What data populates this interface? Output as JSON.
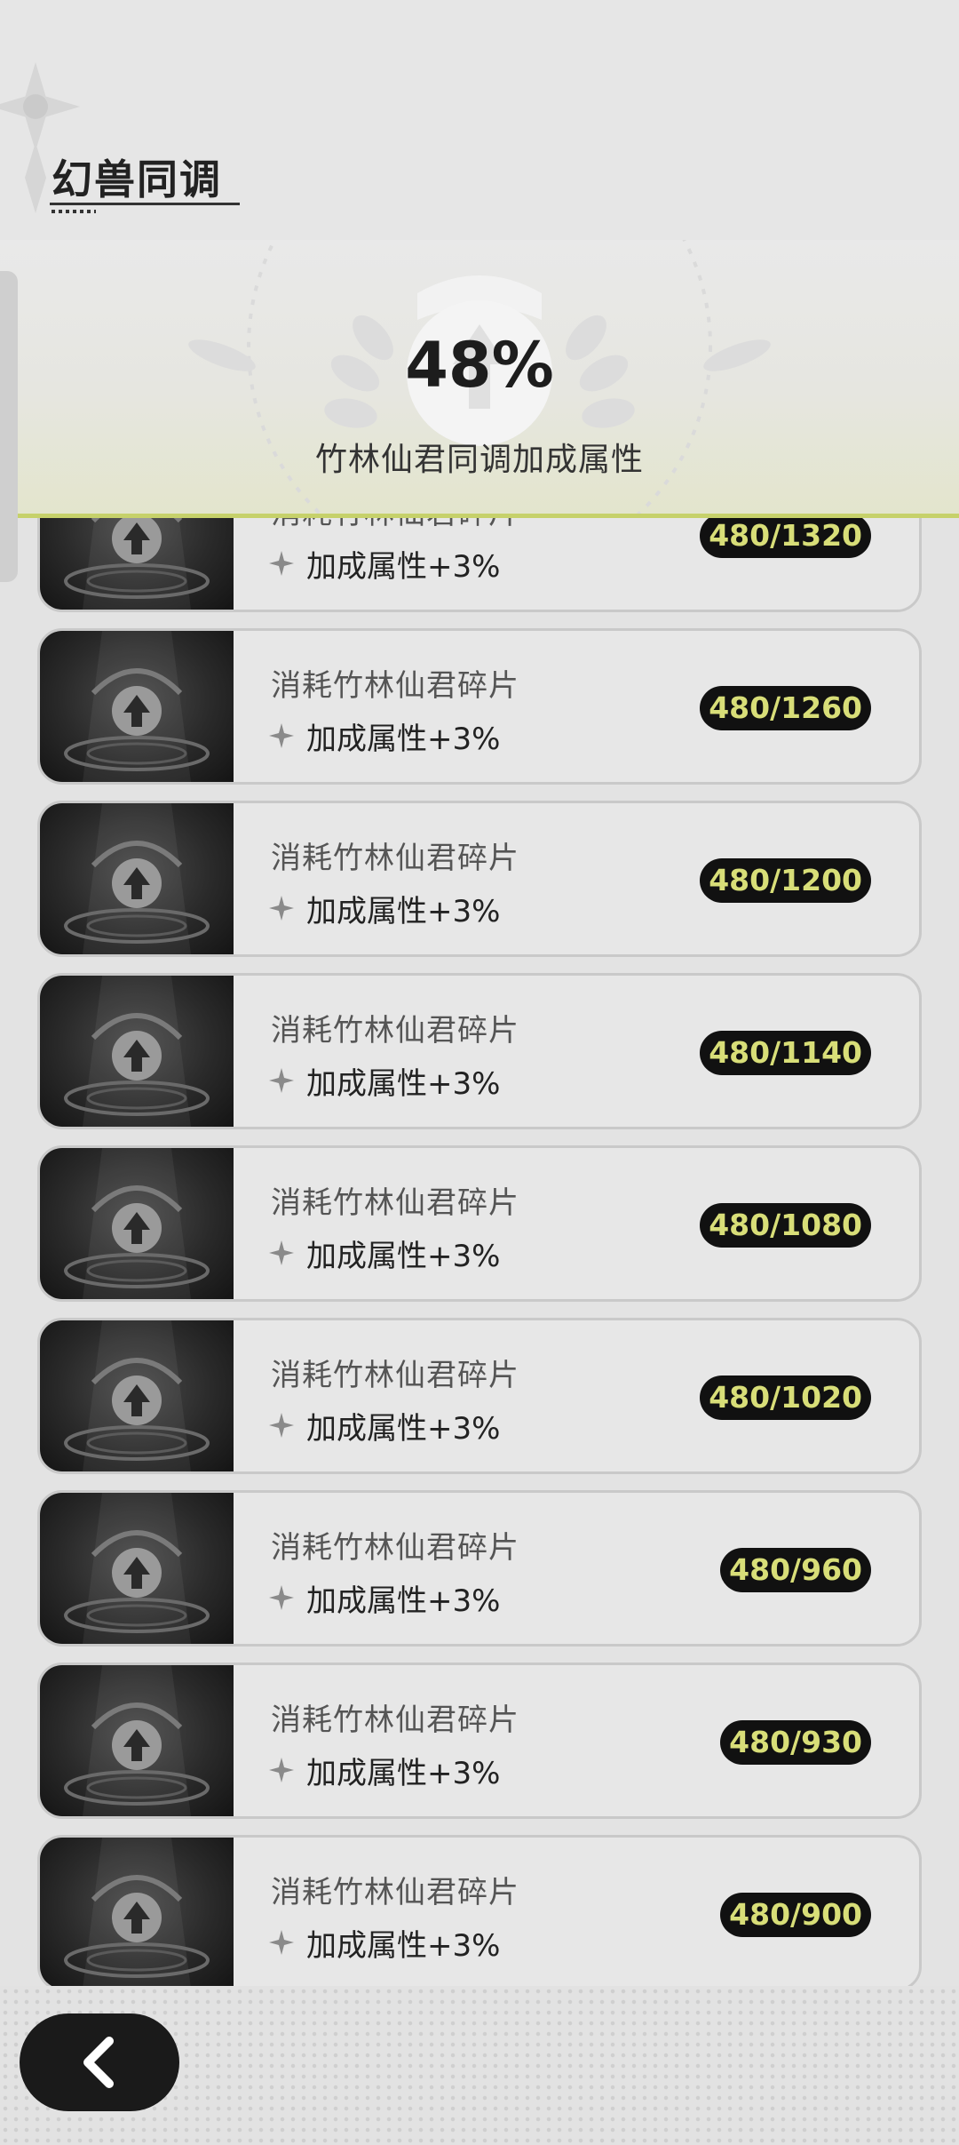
{
  "header": {
    "title": "幻兽同调"
  },
  "banner": {
    "percent": "48%",
    "subtitle": "竹林仙君同调加成属性"
  },
  "list": {
    "items": [
      {
        "title": "消耗竹林仙君碎片",
        "bonus": "加成属性+3%",
        "count": "480/1320"
      },
      {
        "title": "消耗竹林仙君碎片",
        "bonus": "加成属性+3%",
        "count": "480/1260"
      },
      {
        "title": "消耗竹林仙君碎片",
        "bonus": "加成属性+3%",
        "count": "480/1200"
      },
      {
        "title": "消耗竹林仙君碎片",
        "bonus": "加成属性+3%",
        "count": "480/1140"
      },
      {
        "title": "消耗竹林仙君碎片",
        "bonus": "加成属性+3%",
        "count": "480/1080"
      },
      {
        "title": "消耗竹林仙君碎片",
        "bonus": "加成属性+3%",
        "count": "480/1020"
      },
      {
        "title": "消耗竹林仙君碎片",
        "bonus": "加成属性+3%",
        "count": "480/960"
      },
      {
        "title": "消耗竹林仙君碎片",
        "bonus": "加成属性+3%",
        "count": "480/930"
      },
      {
        "title": "消耗竹林仙君碎片",
        "bonus": "加成属性+3%",
        "count": "480/900"
      }
    ]
  },
  "footer": {
    "back_icon": "chevron-left-icon"
  },
  "colors": {
    "accent": "#c6d16a",
    "badge_text": "#d8de78",
    "badge_bg": "#111111"
  }
}
